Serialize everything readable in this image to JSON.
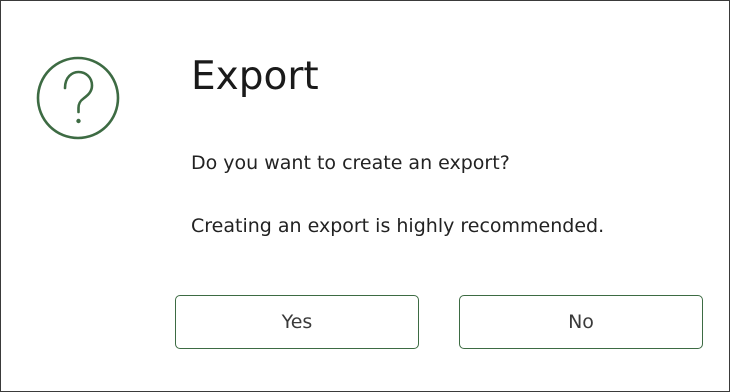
{
  "dialog": {
    "title": "Export",
    "icon": "question-circle-icon",
    "accent_color": "#3d6b43",
    "messages": [
      "Do you want to create an export?",
      "Creating an export is highly recommended."
    ],
    "buttons": {
      "yes_label": "Yes",
      "no_label": "No"
    }
  }
}
